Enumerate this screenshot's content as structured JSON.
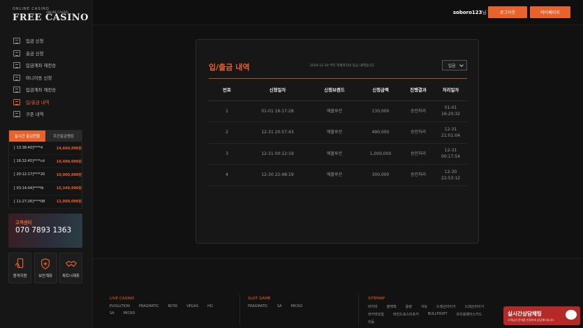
{
  "logo": {
    "small": "ONLINE CASINO",
    "big": "FREE CASINO",
    "sub": "ONLINE CASINO"
  },
  "sidebar": {
    "items": [
      {
        "label": "입금 신청",
        "active": false
      },
      {
        "label": "출금 신청",
        "active": false
      },
      {
        "label": "입금계좌 재전송",
        "active": false
      },
      {
        "label": "머니이동 신청",
        "active": false
      },
      {
        "label": "입금계좌 재전송",
        "active": false
      },
      {
        "label": "입/출금 내역",
        "active": true
      },
      {
        "label": "쿠폰 내역",
        "active": false
      }
    ]
  },
  "live": {
    "tabs": [
      "실시간 출금현황",
      "주간출금랭킹"
    ],
    "rows": [
      {
        "time": "[ 13:38:40]",
        "user": "****4",
        "amount": "14,660,000원"
      },
      {
        "time": "[ 16:32:45]",
        "user": "****cd",
        "amount": "10,490,000원"
      },
      {
        "time": "[ 20:12:17]",
        "user": "****20",
        "amount": "10,000,000원"
      },
      {
        "time": "[ 03:14:04]",
        "user": "****fk",
        "amount": "15,340,000원"
      },
      {
        "time": "[ 11:27:26]",
        "user": "****08",
        "amount": "12,000,000원"
      }
    ]
  },
  "cs": {
    "title": "고객센터",
    "phone": "070 7893 1363"
  },
  "quick": [
    {
      "label": "원격지원",
      "icon": "remote-support-icon"
    },
    {
      "label": "보안계좌",
      "icon": "secure-account-icon"
    },
    {
      "label": "파트너제휴",
      "icon": "partner-handshake-icon"
    }
  ],
  "header": {
    "username": "soboro123",
    "suffix": "님",
    "logout": "로그아웃",
    "mypage": "마이페이지"
  },
  "panel": {
    "title": "입/출금 내역",
    "desc": "2024-12-30 부터 현재까지의 입금 내역입니다.",
    "select": "입금",
    "columns": [
      "번호",
      "신청일자",
      "신청브랜드",
      "신청금액",
      "진행결과",
      "처리일자"
    ],
    "rows": [
      {
        "no": "1",
        "date": "01-01 16:17:28",
        "brand": "에볼루션",
        "amount": "130,000",
        "result": "승인처리",
        "proc1": "01-01",
        "proc2": "16:20:32"
      },
      {
        "no": "2",
        "date": "12-31 20:57:43",
        "brand": "에볼루션",
        "amount": "490,000",
        "result": "승인처리",
        "proc1": "12-31",
        "proc2": "21:01:04"
      },
      {
        "no": "3",
        "date": "12-31 00:12:19",
        "brand": "에볼루션",
        "amount": "1,000,000",
        "result": "승인처리",
        "proc1": "12-31",
        "proc2": "00:17:54"
      },
      {
        "no": "4",
        "date": "12-30 22:48:19",
        "brand": "에볼루션",
        "amount": "300,000",
        "result": "승인처리",
        "proc1": "12-30",
        "proc2": "22:53:12"
      }
    ]
  },
  "footer": {
    "live": {
      "title": "LIVE CASINO",
      "links": [
        "EVOLUTION",
        "PRAGMATIC",
        "BOTA",
        "VEGAS",
        "HO",
        "SA",
        "MICRO"
      ]
    },
    "slot": {
      "title": "SLOT GAME",
      "links": [
        "PRAGMATIC",
        "SA",
        "MICRO"
      ]
    },
    "sitemap": {
      "title": "SITEMAP",
      "links": [
        "바카라",
        "블랙잭",
        "룰렛",
        "식보",
        "드래곤타이거",
        "드래곤타이거",
        "바카라보험",
        "레전드포스터포커",
        "BULLFIGHT",
        "프리롤페이스카드",
        "미동"
      ]
    }
  },
  "chat": {
    "title": "실시간상담채팅",
    "sub": "고객님의 문의를 친절하게 상담해드립니다"
  },
  "colors": {
    "accent": "#e8622c",
    "bg": "#111111"
  }
}
